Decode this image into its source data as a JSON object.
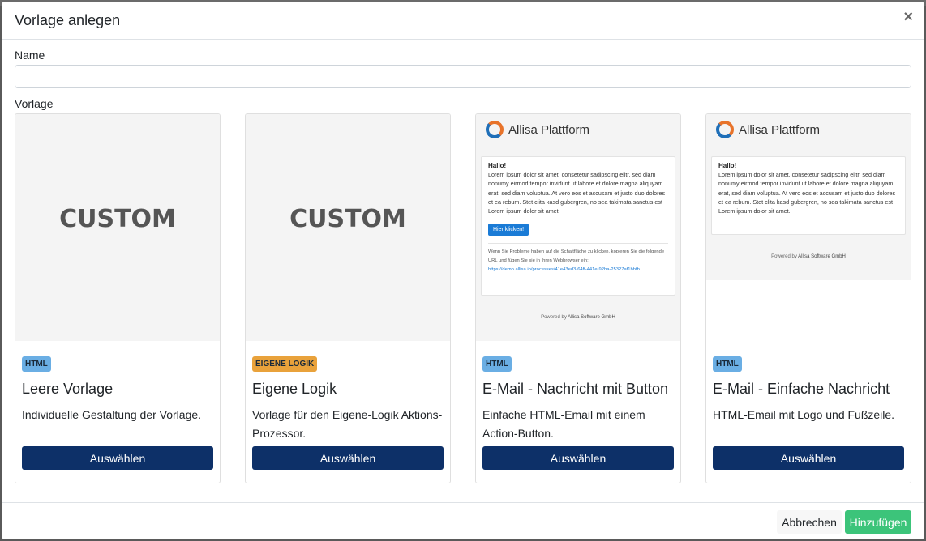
{
  "modal": {
    "title": "Vorlage anlegen",
    "close_icon": "×",
    "name_label": "Name",
    "name_value": "",
    "template_label": "Vorlage"
  },
  "cards": [
    {
      "preview_text": "CUSTOM",
      "badge": "HTML",
      "title": "Leere Vorlage",
      "description": "Individuelle Gestaltung der Vorlage.",
      "button": "Auswählen"
    },
    {
      "preview_text": "CUSTOM",
      "badge": "EIGENE LOGIK",
      "title": "Eigene Logik",
      "description": "Vorlage für den Eigene-Logik Aktions-Prozessor.",
      "button": "Auswählen"
    },
    {
      "logo": "Allisa Plattform",
      "email_hello": "Hallo!",
      "email_body": "Lorem ipsum dolor sit amet, consetetur sadipscing elitr, sed diam nonumy eirmod tempor invidunt ut labore et dolore magna aliquyam erat, sed diam voluptua. At vero eos et accusam et justo duo dolores et ea rebum. Stet clita kasd gubergren, no sea takimata sanctus est Lorem ipsum dolor sit amet.",
      "email_button": "Hier klicken!",
      "email_hint": "Wenn Sie Probleme haben auf die Schaltfläche zu klicken, kopieren Sie die folgende URL und fügen Sie sie in Ihren Webbrowser ein:",
      "email_link": "https://demo.allisa.io/processes/41e43ed3-64ff-441e-92ba-25327af1bbfb",
      "powered_prefix": "Powered by",
      "powered_company": "Allisa Software GmbH",
      "badge": "HTML",
      "title": "E-Mail - Nachricht mit Button",
      "description": "Einfache HTML-Email mit einem Action-Button.",
      "button": "Auswählen"
    },
    {
      "logo": "Allisa Plattform",
      "email_hello": "Hallo!",
      "email_body": "Lorem ipsum dolor sit amet, consetetur sadipscing elitr, sed diam nonumy eirmod tempor invidunt ut labore et dolore magna aliquyam erat, sed diam voluptua. At vero eos et accusam et justo duo dolores et ea rebum. Stet clita kasd gubergren, no sea takimata sanctus est Lorem ipsum dolor sit amet.",
      "powered_prefix": "Powered by",
      "powered_company": "Allisa Software GmbH",
      "badge": "HTML",
      "title": "E-Mail - Einfache Nachricht",
      "description": "HTML-Email mit Logo und Fußzeile.",
      "button": "Auswählen"
    }
  ],
  "footer": {
    "cancel": "Abbrechen",
    "add": "Hinzufügen"
  },
  "colors": {
    "primary": "#0d3068",
    "success": "#3cc47a",
    "badge_html": "#6aaee4",
    "badge_logic": "#e9a23b"
  },
  "icons": {
    "close": "close-icon",
    "logo": "allisa-logo-icon"
  }
}
